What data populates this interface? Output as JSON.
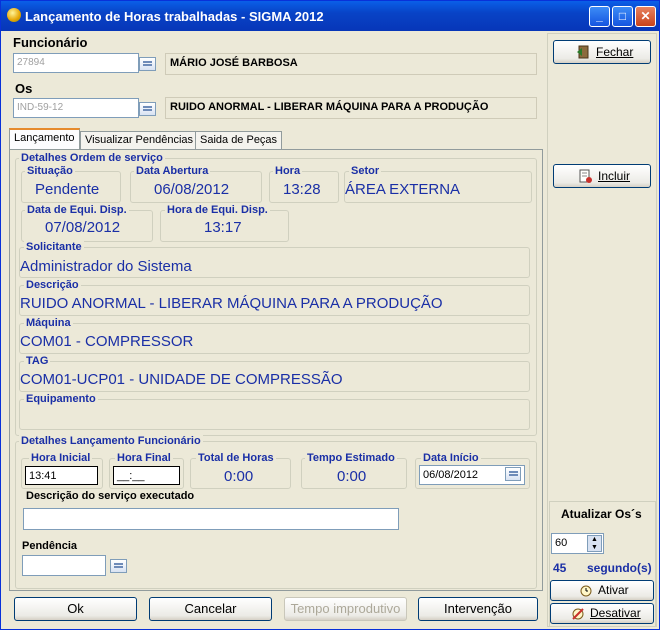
{
  "window": {
    "title": "Lançamento de Horas trabalhadas - SIGMA 2012",
    "minimize": "_",
    "maximize": "□",
    "close": "✕"
  },
  "header": {
    "funcionario_label": "Funcionário",
    "funcionario_code": "27894",
    "funcionario_name": "MÁRIO JOSÉ BARBOSA",
    "os_label": "Os",
    "os_code": "IND-59-12",
    "os_desc": "RUIDO ANORMAL - LIBERAR MÁQUINA PARA A PRODUÇÃO"
  },
  "tabs": [
    "Lançamento",
    "Visualizar Pendências",
    "Saida de Peças"
  ],
  "os_details": {
    "legend": "Detalhes Ordem de serviço",
    "situacao_label": "Situação",
    "situacao": "Pendente",
    "data_abertura_label": "Data Abertura",
    "data_abertura": "06/08/2012",
    "hora_label": "Hora",
    "hora": "13:28",
    "setor_label": "Setor",
    "setor": "ÁREA EXTERNA",
    "data_equi_label": "Data de Equi. Disp.",
    "data_equi": "07/08/2012",
    "hora_equi_label": "Hora de Equi. Disp.",
    "hora_equi": "13:17",
    "solicitante_label": "Solicitante",
    "solicitante": "Administrador do Sistema",
    "descricao_label": "Descrição",
    "descricao": "RUIDO ANORMAL - LIBERAR MÁQUINA PARA A PRODUÇÃO",
    "maquina_label": "Máquina",
    "maquina": "COM01 - COMPRESSOR",
    "tag_label": "TAG",
    "tag": "COM01-UCP01 - UNIDADE DE COMPRESSÃO",
    "equipamento_label": "Equipamento",
    "equipamento": ""
  },
  "lancamento": {
    "legend": "Detalhes Lançamento Funcionário",
    "hora_inicial_label": "Hora Inicial",
    "hora_inicial": "13:41",
    "hora_final_label": "Hora Final",
    "hora_final": "__:__",
    "total_horas_label": "Total de Horas",
    "total_horas": "0:00",
    "tempo_estimado_label": "Tempo Estimado",
    "tempo_estimado": "0:00",
    "data_inicio_label": "Data Início",
    "data_inicio": "06/08/2012",
    "descricao_servico_label": "Descrição do serviço executado",
    "pendencia_label": "Pendência"
  },
  "buttons": {
    "ok": "Ok",
    "cancelar": "Cancelar",
    "tempo": "Tempo improdutivo",
    "intervencao": "Intervenção"
  },
  "sidebar": {
    "fechar": "Fechar",
    "incluir": "Incluir",
    "atualizar_label": "Atualizar Os´s",
    "atualizar_value": "60",
    "countdown": "45",
    "segundos": "segundo(s)",
    "ativar": "Ativar",
    "desativar": "Desativar"
  }
}
